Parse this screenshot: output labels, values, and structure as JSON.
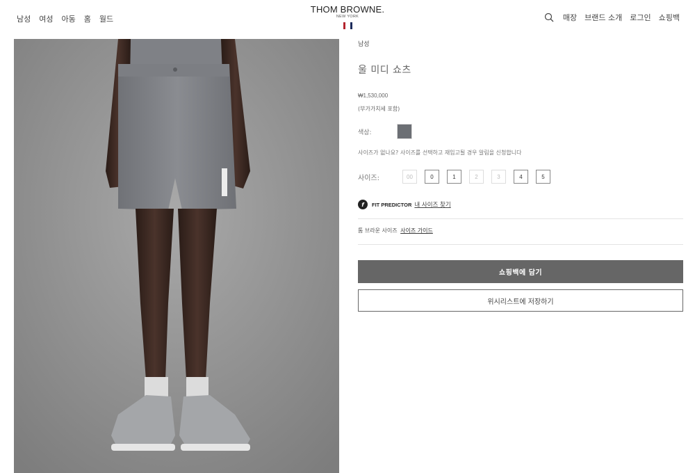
{
  "header": {
    "nav_left": [
      "남성",
      "여성",
      "아동",
      "홈",
      "월드"
    ],
    "logo": {
      "main": "THOM BROWNE.",
      "sub": "NEW YORK"
    },
    "nav_right": [
      "매장",
      "브랜드 소개",
      "로그인",
      "쇼핑백"
    ],
    "flag_colors": [
      "#b4252e",
      "#ffffff",
      "#1b2b5b"
    ]
  },
  "product": {
    "category": "남성",
    "title": "울 미디 쇼츠",
    "price": "₩1,530,000",
    "vat_note": "(부가가치세 포함)",
    "color_label": "색상:",
    "color_swatch": "#6c6f74",
    "size_notice": "사이즈가 없나요? 사이즈를 선택하고 재입고될 경우 알림을 신청합니다",
    "size_label": "사이즈:",
    "sizes": [
      {
        "label": "00",
        "available": false
      },
      {
        "label": "0",
        "available": true
      },
      {
        "label": "1",
        "available": true
      },
      {
        "label": "2",
        "available": false
      },
      {
        "label": "3",
        "available": false
      },
      {
        "label": "4",
        "available": true
      },
      {
        "label": "5",
        "available": true
      }
    ],
    "fit_predictor": {
      "icon": "f",
      "title": "FIT PREDICTOR",
      "link": "내 사이즈 찾기"
    },
    "size_guide": {
      "prefix": "톰 브라운 사이즈",
      "link": "사이즈 가이드"
    },
    "add_to_bag": "쇼핑백에 담기",
    "wishlist": "위시리스트에 저장하기"
  }
}
